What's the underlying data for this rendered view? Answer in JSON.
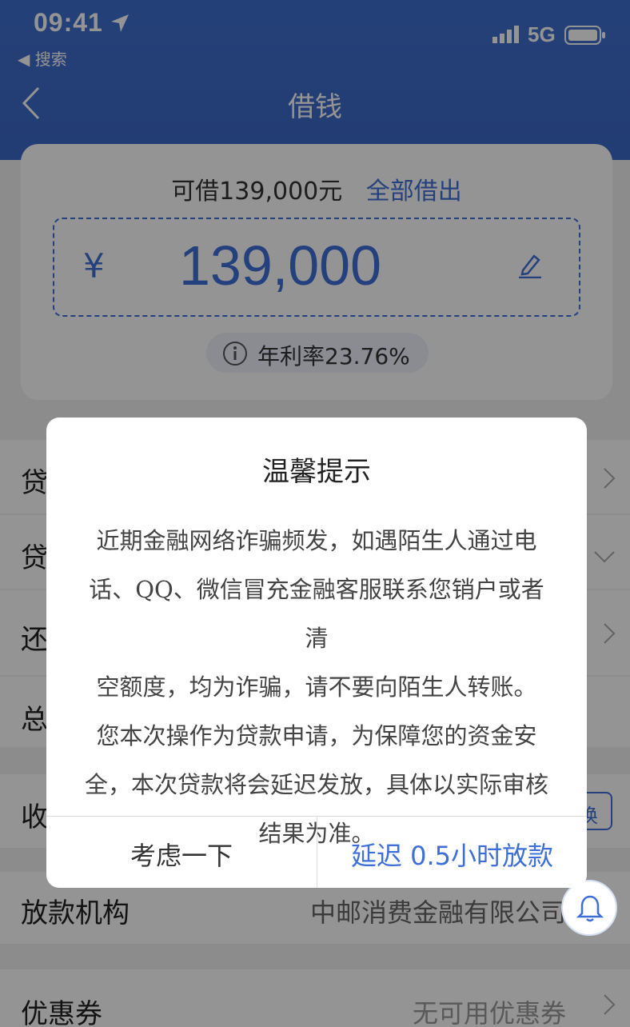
{
  "status_bar": {
    "time": "09:41",
    "back_label": "◀ 搜索",
    "network": "5G"
  },
  "nav": {
    "title": "借钱"
  },
  "loan_card": {
    "available_text": "可借139,000元",
    "borrow_all_label": "全部借出",
    "currency_symbol": "¥",
    "amount": "139,000",
    "annual_rate_text": "年利率23.76%"
  },
  "rows": [
    {
      "label": "贷"
    },
    {
      "label": "贷"
    },
    {
      "label": "还"
    },
    {
      "label": "总"
    },
    {
      "label": "收"
    }
  ],
  "change_button_label": "换",
  "lender": {
    "label": "放款机构",
    "value": "中邮消费金融有限公司"
  },
  "coupon": {
    "label": "优惠券",
    "value": "无可用优惠券"
  },
  "dialog": {
    "title": "温馨提示",
    "body_lines": [
      "近期金融网络诈骗频发，如遇陌生人通过电",
      "话、QQ、微信冒充金融客服联系您销户或者清",
      "空额度，均为诈骗，请不要向陌生人转账。",
      "您本次操作为贷款申请，为保障您的资金安",
      "全，本次贷款将会延迟发放，具体以实际审核",
      "结果为准。"
    ],
    "cancel_label": "考虑一下",
    "confirm_label": "延迟 0.5小时放款"
  },
  "colors": {
    "primary": "#3e6fd8",
    "header": "#3c69c6",
    "overlay": "rgba(0,0,0,0.42)"
  }
}
